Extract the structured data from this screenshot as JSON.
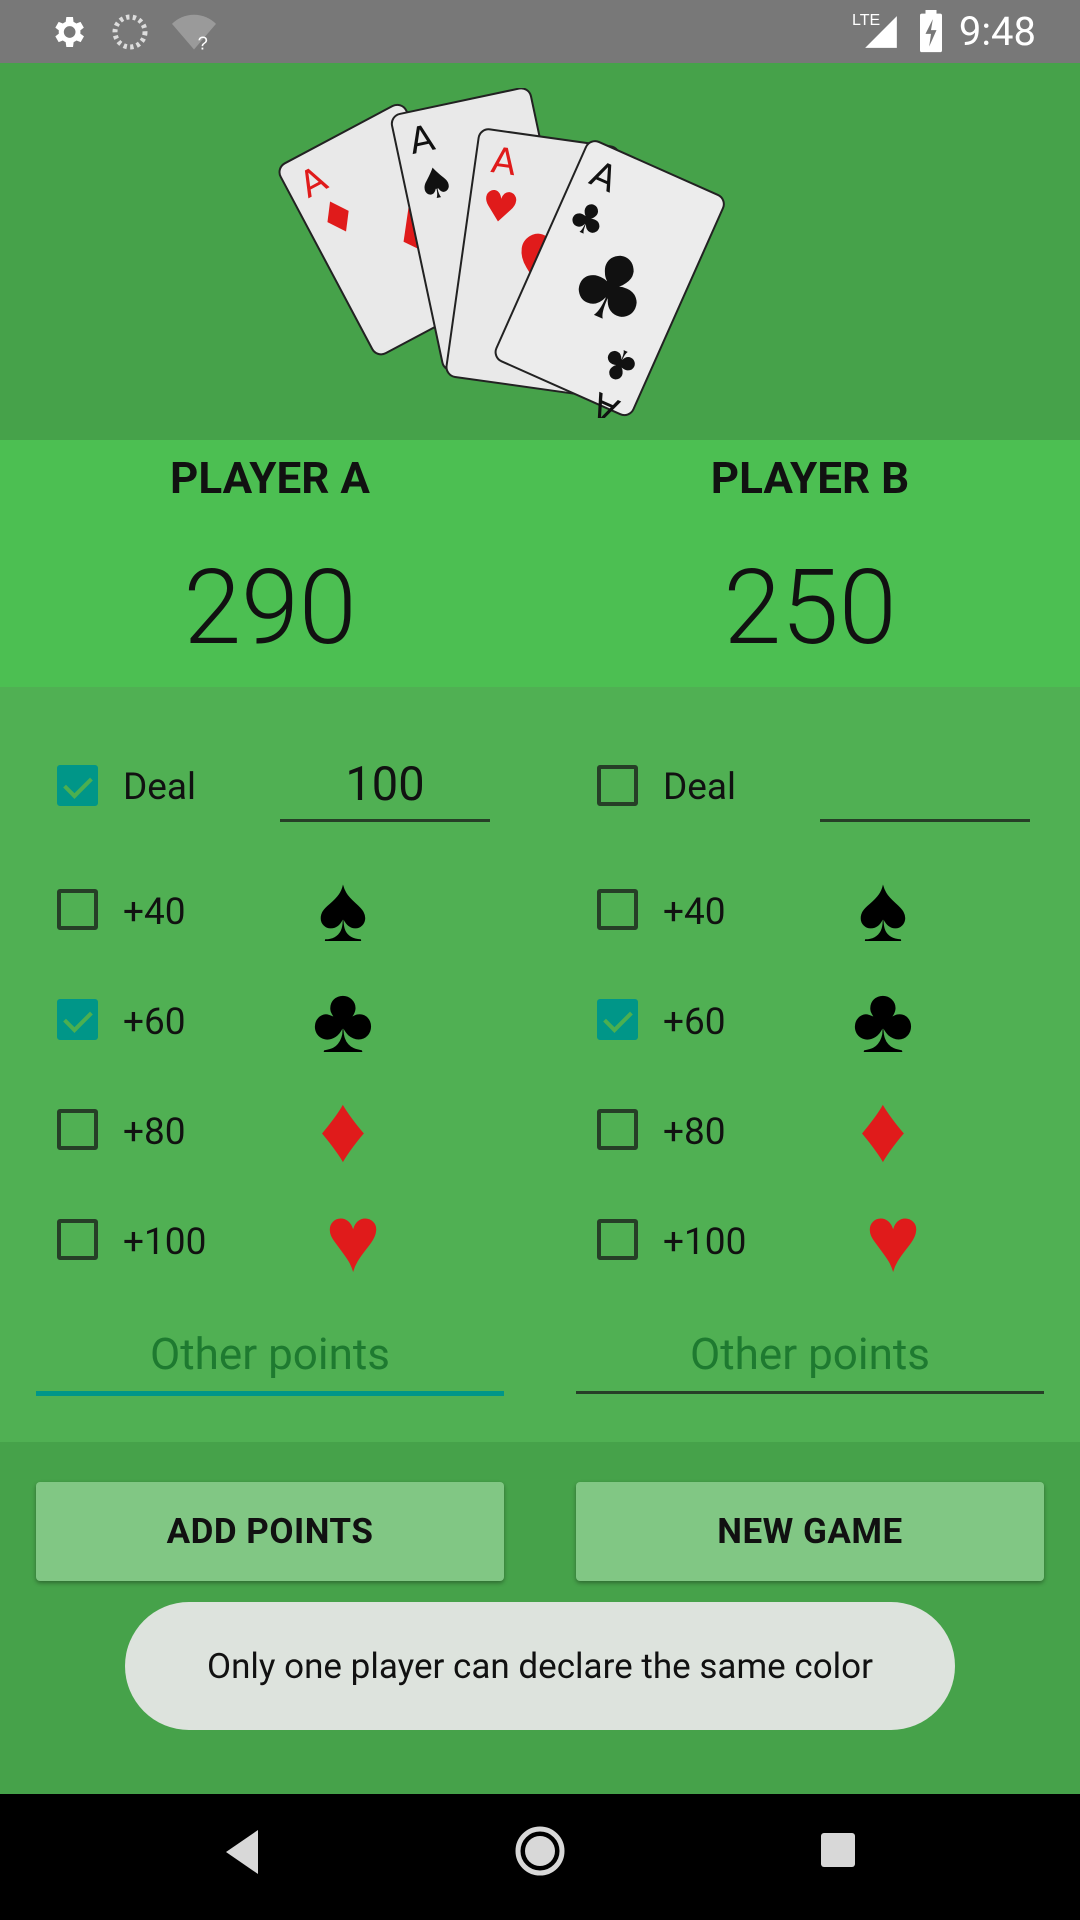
{
  "status_bar": {
    "network": "LTE",
    "time": "9:48"
  },
  "players": [
    {
      "name": "PLAYER A",
      "score": "290",
      "deal_label": "Deal",
      "deal_value": "100",
      "deal_checked": true,
      "bonuses": [
        {
          "label": "+40",
          "suit": "♠",
          "color": "black",
          "checked": false
        },
        {
          "label": "+60",
          "suit": "♣",
          "color": "black",
          "checked": true
        },
        {
          "label": "+80",
          "suit": "♦",
          "color": "red",
          "checked": false
        },
        {
          "label": "+100",
          "suit": "♥",
          "color": "red",
          "checked": false
        }
      ],
      "other_points_placeholder": "Other points"
    },
    {
      "name": "PLAYER B",
      "score": "250",
      "deal_label": "Deal",
      "deal_value": "",
      "deal_checked": false,
      "bonuses": [
        {
          "label": "+40",
          "suit": "♠",
          "color": "black",
          "checked": false
        },
        {
          "label": "+60",
          "suit": "♣",
          "color": "black",
          "checked": true
        },
        {
          "label": "+80",
          "suit": "♦",
          "color": "red",
          "checked": false
        },
        {
          "label": "+100",
          "suit": "♥",
          "color": "red",
          "checked": false
        }
      ],
      "other_points_placeholder": "Other points"
    }
  ],
  "buttons": {
    "add_points": "ADD POINTS",
    "new_game": "NEW GAME"
  },
  "toast": "Only one player can declare the same color",
  "colors": {
    "accent": "#009688",
    "button": "#81c784"
  }
}
